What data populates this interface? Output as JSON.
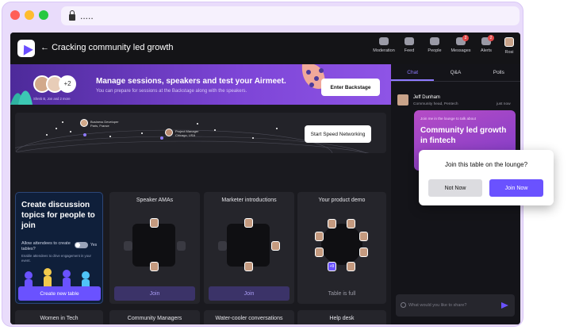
{
  "browser": {
    "url": "....."
  },
  "header": {
    "title": "Cracking community led growth"
  },
  "nav": [
    {
      "label": "Moderation",
      "badge": ""
    },
    {
      "label": "Feed",
      "badge": ""
    },
    {
      "label": "People",
      "badge": ""
    },
    {
      "label": "Messages",
      "badge": "2"
    },
    {
      "label": "Alerts",
      "badge": "2"
    },
    {
      "label": "Rosi",
      "badge": ""
    }
  ],
  "banner": {
    "title": "Manage sessions, speakers and test your Airmeet.",
    "subtitle": "You can prepare for sessions at the Backstage along with the speakers.",
    "count": "+2",
    "speakers_note": "Shreb B, Jon and 2 more",
    "button": "Enter Backstage"
  },
  "networking": {
    "button": "Start Speed Networking",
    "pin1_role": "Business Developer",
    "pin1_loc": "Paris, France",
    "pin2_role": "Project Manager",
    "pin2_loc": "Chicago, USA"
  },
  "discuss": {
    "title": "Create discussion topics for people to join",
    "allow": "Allow attendees to create tables?",
    "toggle": "Yes",
    "enable": "Enable attendees to drive engagement in your event.",
    "button": "Create new table"
  },
  "tables": [
    {
      "title": "Speaker AMAs",
      "action": "Join"
    },
    {
      "title": "Marketer introductions",
      "action": "Join"
    },
    {
      "title": "Your product demo",
      "action": "Table is full",
      "extra": "+9"
    }
  ],
  "bottom_tables": [
    "Women in Tech",
    "Community Managers",
    "Water-cooler conversations",
    "Help desk"
  ],
  "chat": {
    "tabs": [
      "Chat",
      "Q&A",
      "Polls"
    ],
    "sender": "Jeff Dunham",
    "sender_sub": "Community head, Pentech",
    "time": "just now",
    "card_top": "Join me in the lounge to talk about",
    "card_title": "Community led growth in fintech",
    "placeholder": "What would you like to share?"
  },
  "popup": {
    "question": "Join this table on the lounge?",
    "no": "Not Now",
    "yes": "Join Now"
  }
}
